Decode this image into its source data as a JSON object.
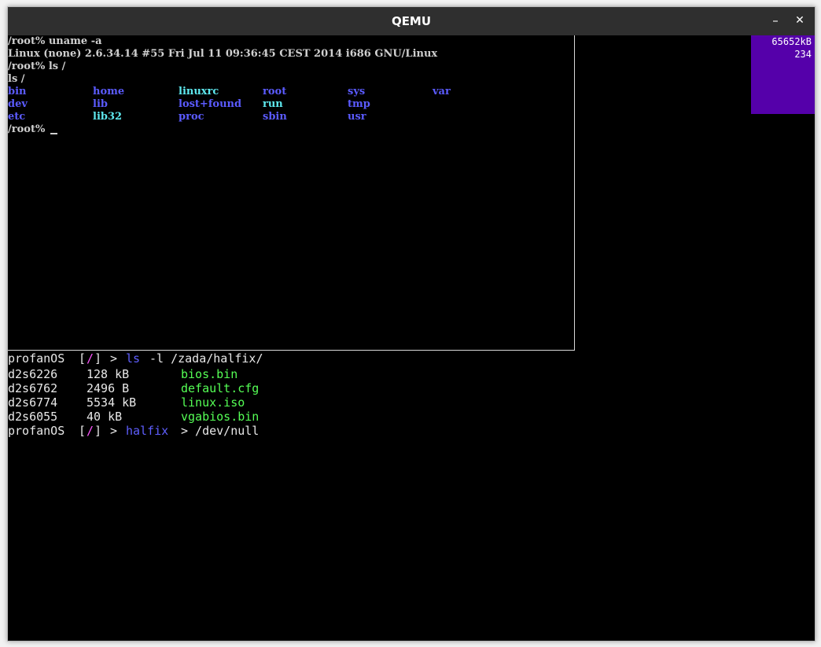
{
  "window": {
    "title": "QEMU",
    "minimize_glyph": "–",
    "close_glyph": "✕"
  },
  "guest": {
    "lines": [
      "/root% uname -a",
      "Linux (none) 2.6.34.14 #55 Fri Jul 11 09:36:45 CEST 2014 i686 GNU/Linux",
      "/root% ls /",
      "ls /"
    ],
    "ls_columns": [
      [
        "bin",
        "dev",
        "etc"
      ],
      [
        "home",
        "lib",
        "lib32"
      ],
      [
        "linuxrc",
        "lost+found",
        "proc"
      ],
      [
        "root",
        "run",
        "sbin"
      ],
      [
        "sys",
        "tmp",
        "usr"
      ],
      [
        "var"
      ]
    ],
    "prompt": "/root% "
  },
  "memory": {
    "used": "65652kB",
    "count": "234"
  },
  "shell": {
    "prompt_name": "profanOS",
    "open_bracket": "[",
    "path": "/",
    "close_bracket": "]",
    "arrow": ">",
    "cmd1_program": "ls",
    "cmd1_args": "-l /zada/halfix/",
    "files": [
      {
        "id": "d2s6226",
        "size": "128 kB",
        "name": "bios.bin"
      },
      {
        "id": "d2s6762",
        "size": "2496 B",
        "name": "default.cfg"
      },
      {
        "id": "d2s6774",
        "size": "5534 kB",
        "name": "linux.iso"
      },
      {
        "id": "d2s6055",
        "size": "40 kB",
        "name": "vgabios.bin"
      }
    ],
    "cmd2_program": "halfix",
    "cmd2_redirect": "> /dev/null"
  },
  "colors": {
    "titlebar": "#2f2f2f",
    "memory_panel": "#5500aa",
    "dir_blue": "#5b5bff",
    "dir_cyan": "#5ee8ee",
    "path_pink": "#ff55ff",
    "file_green": "#55ff55"
  }
}
